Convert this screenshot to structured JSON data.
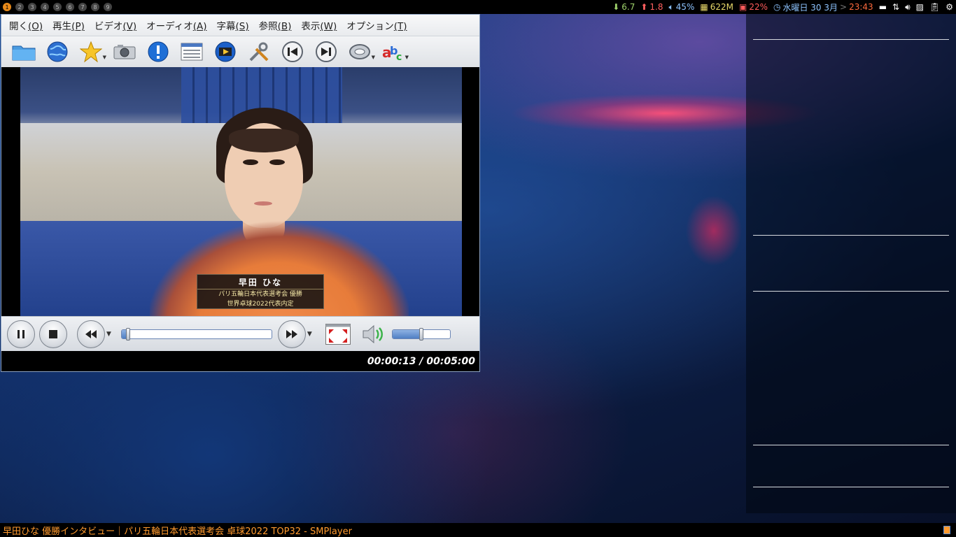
{
  "colors": {
    "accent": "#e88a1a",
    "taskbar_text": "#ff9a2e",
    "net_down": "#9fd36b",
    "net_up": "#ff6060",
    "clock": "#ff6a3d"
  },
  "top_panel": {
    "workspaces": [
      "1",
      "2",
      "3",
      "4",
      "5",
      "6",
      "7",
      "8",
      "9"
    ],
    "active_workspace": "1",
    "net_down": "6.7",
    "net_up": "1.8",
    "volume": "45%",
    "memory": "622M",
    "cpu": "22%",
    "date": "水曜日 30 3月",
    "separator": ">",
    "time": "23:43"
  },
  "player": {
    "menu": [
      {
        "label": "開く",
        "key": "(O)"
      },
      {
        "label": "再生",
        "key": "(P)"
      },
      {
        "label": "ビデオ",
        "key": "(V)"
      },
      {
        "label": "オーディオ",
        "key": "(A)"
      },
      {
        "label": "字幕",
        "key": "(S)"
      },
      {
        "label": "参照",
        "key": "(B)"
      },
      {
        "label": "表示",
        "key": "(W)"
      },
      {
        "label": "オプション",
        "key": "(T)"
      }
    ],
    "toolbar_icons": [
      "folder-icon",
      "globe-icon",
      "favorites-star-icon",
      "screenshot-camera-icon",
      "info-icon",
      "playlist-icon",
      "video-clip-icon",
      "preferences-tools-icon",
      "previous-icon",
      "next-icon",
      "audio-track-icon",
      "subtitles-icon"
    ],
    "caption": {
      "name": "早田 ひな",
      "line1": "パリ五輪日本代表選考会 優勝",
      "line2": "世界卓球2022代表内定"
    },
    "seek_progress": 0.043,
    "volume_level": 0.5,
    "time_display": "00:00:13 / 00:05:00"
  },
  "taskbar": {
    "window_title": "早田ひな 優勝インタビュー｜パリ五輪日本代表選考会 卓球2022 TOP32 - SMPlayer"
  }
}
